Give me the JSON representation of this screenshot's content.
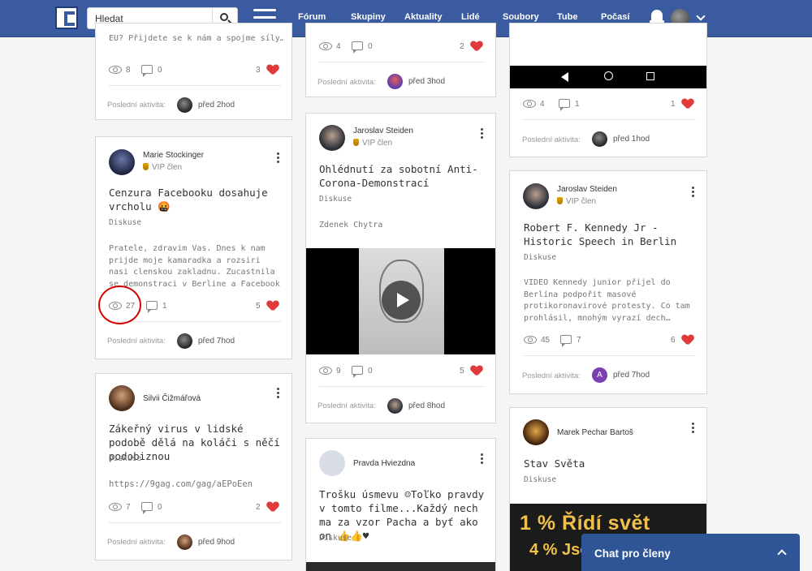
{
  "header": {
    "search_placeholder": "Hledat",
    "nav": [
      "Fórum",
      "Skupiny",
      "Aktuality",
      "Lidé",
      "Soubory",
      "Tube",
      "Počasí"
    ]
  },
  "activity_label": "Poslední aktivita:",
  "vip_label": "VIP člen",
  "columns": {
    "col1": [
      {
        "excerpt_partial": "EU? Přijdete se k nám a spojme síly…",
        "views": "8",
        "comments": "0",
        "likes": "3",
        "last_activity": "před 2hod"
      },
      {
        "author": "Marie Stockinger",
        "title": "Cenzura Facebooku dosahuje vrcholu 🤬",
        "category": "Diskuse",
        "excerpt": "Pratele, zdravim Vas. Dnes k nam prijde moje kamaradka a rozsiri nasi clenskou zakladnu. Zucastnila se demonstraci v Berline a Facebook ji…",
        "views": "27",
        "comments": "1",
        "likes": "5",
        "last_activity": "před 7hod"
      },
      {
        "author": "Silvii Čižmářová",
        "title": "Zákeřný virus v lidské podobě dělá na koláči s něčí podobiznou",
        "category": "Diskuse",
        "link": "https://9gag.com/gag/aEPoEen",
        "views": "7",
        "comments": "0",
        "likes": "2",
        "last_activity": "před 9hod"
      }
    ],
    "col2": [
      {
        "views": "4",
        "comments": "0",
        "likes": "2",
        "last_activity": "před 3hod"
      },
      {
        "author": "Jaroslav Steiden",
        "title": "Ohlédnutí za sobotní Anti-Corona-Demonstrací",
        "category": "Diskuse",
        "excerpt": "Zdenek Chytra",
        "views": "9",
        "comments": "0",
        "likes": "5",
        "last_activity": "před 8hod"
      },
      {
        "author": "Pravda Hviezdna",
        "title": "Trošku úsmevu ☺Toľko pravdy v tomto filme...Každý nech ma za vzor Pacha a byť ako on 👍👍♥",
        "category": "Diskuse"
      }
    ],
    "col3": [
      {
        "views": "4",
        "comments": "1",
        "likes": "1",
        "last_activity": "před 1hod"
      },
      {
        "author": "Jaroslav Steiden",
        "title": "Robert F. Kennedy Jr - Historic Speech in Berlin",
        "category": "Diskuse",
        "excerpt": "VIDEO Kennedy junior přijel do Berlína podpořit masové protikoronavirové protesty. Co tam prohlásil, mnohým vyrazí dech…",
        "views": "45",
        "comments": "7",
        "likes": "6",
        "last_activity": "před 7hod",
        "activity_avatar_letter": "A"
      },
      {
        "author": "Marek Pechar Bartoš",
        "title": "Stav Světa",
        "category": "Diskuse",
        "promo_line1": "1 % Řídí svět",
        "promo_line2": "4 % Jso"
      }
    ]
  },
  "chat": {
    "label": "Chat pro členy"
  },
  "colors": {
    "header": "#3a5ba0",
    "like": "#e03a3a",
    "chat": "#2f5597"
  }
}
